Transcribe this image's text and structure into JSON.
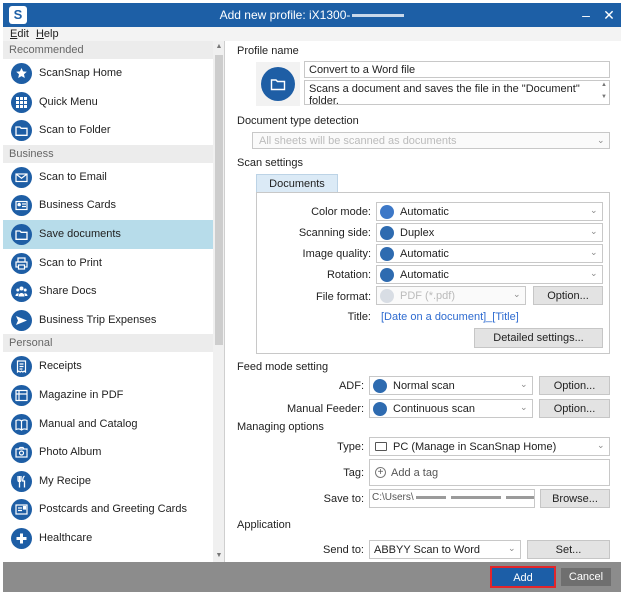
{
  "window": {
    "title": "Add new profile: iX1300-",
    "minimize": "–",
    "close": "✕"
  },
  "menu": [
    "Edit",
    "Help"
  ],
  "sidebar": {
    "sections": [
      {
        "title": "Recommended",
        "items": [
          {
            "label": "ScanSnap Home",
            "icon": "star-icon"
          },
          {
            "label": "Quick Menu",
            "icon": "grid-icon"
          },
          {
            "label": "Scan to Folder",
            "icon": "folder-icon"
          }
        ]
      },
      {
        "title": "Business",
        "items": [
          {
            "label": "Scan to Email",
            "icon": "mail-icon"
          },
          {
            "label": "Business Cards",
            "icon": "card-icon"
          },
          {
            "label": "Save documents",
            "icon": "folder-icon",
            "selected": true
          },
          {
            "label": "Scan to Print",
            "icon": "print-icon"
          },
          {
            "label": "Share Docs",
            "icon": "users-icon"
          },
          {
            "label": "Business Trip Expenses",
            "icon": "plane-icon"
          }
        ]
      },
      {
        "title": "Personal",
        "items": [
          {
            "label": "Receipts",
            "icon": "receipt-icon"
          },
          {
            "label": "Magazine in PDF",
            "icon": "magazine-icon"
          },
          {
            "label": "Manual and Catalog",
            "icon": "book-icon"
          },
          {
            "label": "Photo Album",
            "icon": "photo-icon"
          },
          {
            "label": "My Recipe",
            "icon": "cutlery-icon"
          },
          {
            "label": "Postcards and Greeting Cards",
            "icon": "postcard-icon"
          },
          {
            "label": "Healthcare",
            "icon": "health-icon"
          }
        ]
      }
    ]
  },
  "profile": {
    "heading": "Profile name",
    "name": "Convert to a Word file",
    "description": "Scans a document and saves the file in the \"Document\" folder."
  },
  "doc_type": {
    "heading": "Document type detection",
    "value": "All sheets will be scanned as documents"
  },
  "scan_settings": {
    "heading": "Scan settings",
    "tab": "Documents",
    "rows": [
      {
        "label": "Color mode:",
        "value": "Automatic"
      },
      {
        "label": "Scanning side:",
        "value": "Duplex"
      },
      {
        "label": "Image quality:",
        "value": "Automatic"
      },
      {
        "label": "Rotation:",
        "value": "Automatic"
      }
    ],
    "file_format_label": "File format:",
    "file_format_value": "PDF (*.pdf)",
    "option_label": "Option...",
    "title_label": "Title:",
    "title_value": "[Date on a document]_[Title]",
    "detailed_label": "Detailed settings..."
  },
  "feed": {
    "heading": "Feed mode setting",
    "adf_label": "ADF:",
    "adf_value": "Normal scan",
    "manual_label": "Manual Feeder:",
    "manual_value": "Continuous scan",
    "option_label": "Option..."
  },
  "managing": {
    "heading": "Managing options",
    "type_label": "Type:",
    "type_value": "PC (Manage in ScanSnap Home)",
    "tag_label": "Tag:",
    "tag_add": "Add a tag",
    "save_label": "Save to:",
    "save_value": "C:\\Users\\",
    "browse_label": "Browse..."
  },
  "application": {
    "heading": "Application",
    "send_label": "Send to:",
    "send_value": "ABBYY Scan to Word",
    "set_label": "Set..."
  },
  "footer": {
    "add": "Add",
    "cancel": "Cancel"
  },
  "colors": {
    "brand": "#1d5fa6",
    "selected": "#b7dcea",
    "highlight": "#e2262b"
  }
}
